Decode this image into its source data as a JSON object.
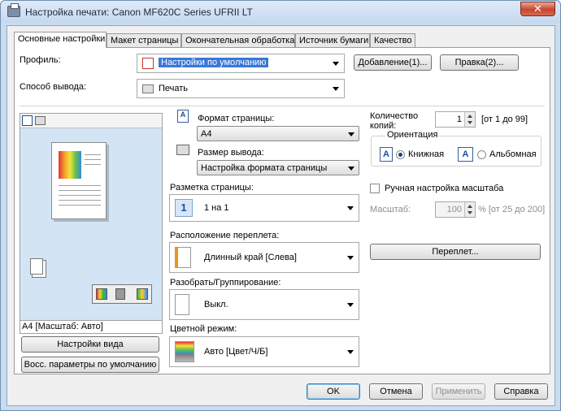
{
  "window": {
    "title": "Настройка печати: Canon MF620C Series UFRII LT",
    "close": "✕"
  },
  "tabs": [
    {
      "label": "Основные настройки"
    },
    {
      "label": "Макет страницы"
    },
    {
      "label": "Окончательная обработка"
    },
    {
      "label": "Источник бумаги"
    },
    {
      "label": "Качество"
    }
  ],
  "profile": {
    "label": "Профиль:",
    "value": "Настройки по умолчанию",
    "add_button": "Добавление(1)...",
    "edit_button": "Правка(2)..."
  },
  "output": {
    "label": "Способ вывода:",
    "value": "Печать"
  },
  "preview": {
    "status": "A4 [Масштаб: Авто]"
  },
  "page_format": {
    "label": "Формат страницы:",
    "value": "A4"
  },
  "output_size": {
    "label": "Размер вывода:",
    "value": "Настройка формата страницы"
  },
  "copies": {
    "label": "Количество копий:",
    "value": "1",
    "range": "[от 1 до 99]"
  },
  "orientation": {
    "label": "Ориентация",
    "portrait": "Книжная",
    "landscape": "Альбомная",
    "selected": "portrait"
  },
  "page_layout": {
    "label": "Разметка страницы:",
    "value": "1 на 1",
    "icon_text": "1"
  },
  "manual_scale": {
    "label": "Ручная настройка масштаба",
    "checked": false
  },
  "scale": {
    "label": "Масштаб:",
    "value": "100",
    "range": "% [от 25 до 200]"
  },
  "binding_location": {
    "label": "Расположение переплета:",
    "value": "Длинный край [Слева]"
  },
  "binding_button": "Переплет...",
  "collate": {
    "label": "Разобрать/Группирование:",
    "value": "Выкл."
  },
  "color_mode": {
    "label": "Цветной режим:",
    "value": "Авто [Цвет/Ч/Б]"
  },
  "view_settings_button": "Настройки вида",
  "restore_defaults_button": "Восс. параметры по умолчанию",
  "footer": {
    "ok": "OK",
    "cancel": "Отмена",
    "apply": "Применить",
    "help": "Справка"
  }
}
